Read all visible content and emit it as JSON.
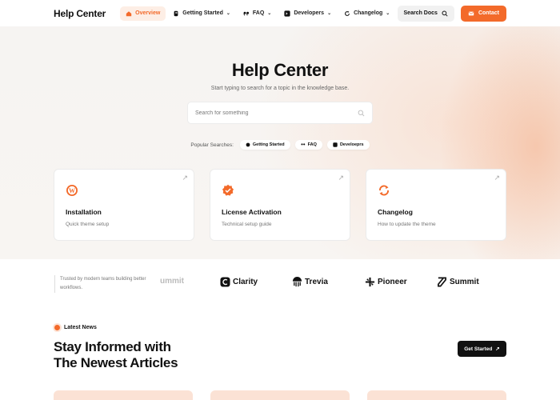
{
  "nav": {
    "brand": "Help Center",
    "items": [
      {
        "label": "Overview",
        "icon": "home-icon",
        "active": true,
        "dropdown": false
      },
      {
        "label": "Getting Started",
        "icon": "rocket-icon",
        "active": false,
        "dropdown": true
      },
      {
        "label": "FAQ",
        "icon": "quote-icon",
        "active": false,
        "dropdown": true
      },
      {
        "label": "Developers",
        "icon": "terminal-icon",
        "active": false,
        "dropdown": true
      },
      {
        "label": "Changelog",
        "icon": "refresh-icon",
        "active": false,
        "dropdown": true
      }
    ],
    "search_label": "Search Docs",
    "contact_label": "Contact"
  },
  "hero": {
    "title": "Help Center",
    "subtitle": "Start typing to search for a topic in the knowledge base.",
    "search_placeholder": "Search for something",
    "popular_label": "Popular Searches:",
    "popular": [
      "Getting Started",
      "FAQ",
      "Develoeprs"
    ]
  },
  "cards": [
    {
      "title": "Installation",
      "subtitle": "Quick theme setup",
      "icon": "wordpress-icon"
    },
    {
      "title": "License Activation",
      "subtitle": "Technical setup guide",
      "icon": "badge-check-icon"
    },
    {
      "title": "Changelog",
      "subtitle": "How to update the theme",
      "icon": "refresh-icon"
    }
  ],
  "trusted": {
    "text": "Trusted by modern teams building better workflows.",
    "logos": [
      "ummit",
      "Clarity",
      "Trevia",
      "Pioneer",
      "Summit"
    ]
  },
  "news": {
    "badge": "Latest News",
    "title_line1": "Stay Informed with",
    "title_line2": "The Newest Articles",
    "cta": "Get Started"
  },
  "colors": {
    "accent": "#f36a2a",
    "dark": "#111111"
  }
}
